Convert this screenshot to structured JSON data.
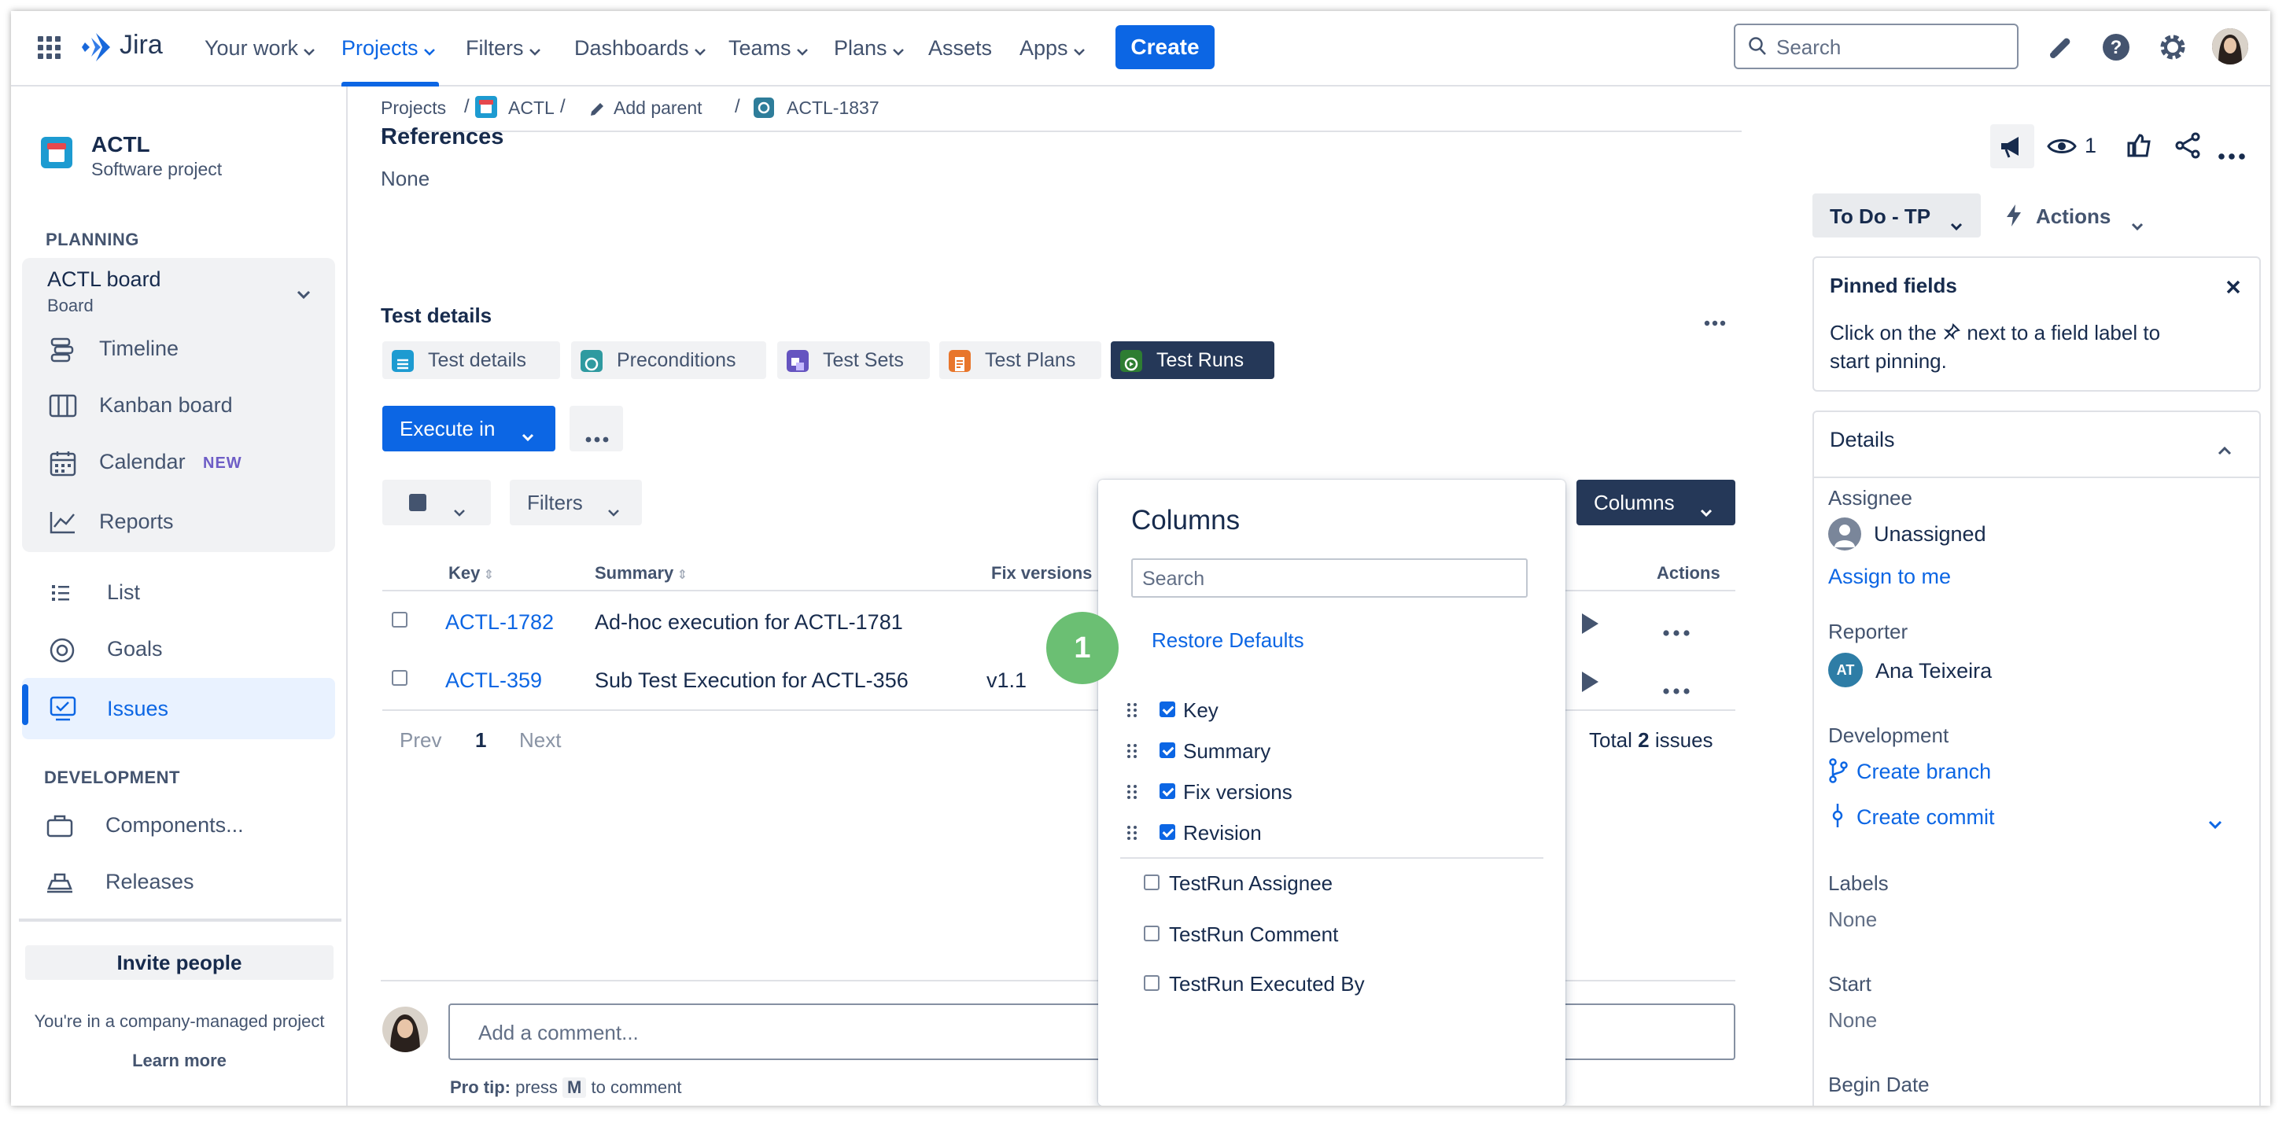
{
  "topnav": {
    "logo_text": "Jira",
    "items": [
      "Your work",
      "Projects",
      "Filters",
      "Dashboards",
      "Teams",
      "Plans",
      "Assets",
      "Apps"
    ],
    "create_label": "Create",
    "search_placeholder": "Search"
  },
  "sidebar": {
    "project_name": "ACTL",
    "project_type": "Software project",
    "planning_label": "PLANNING",
    "board_name": "ACTL board",
    "board_sub": "Board",
    "planning_items": [
      "Timeline",
      "Kanban board",
      "Calendar",
      "Reports"
    ],
    "calendar_badge": "NEW",
    "items": [
      "List",
      "Goals",
      "Issues"
    ],
    "development_label": "DEVELOPMENT",
    "dev_items": [
      "Components...",
      "Releases"
    ],
    "invite_label": "Invite people",
    "managed_text": "You're in a company-managed project",
    "learn_more": "Learn more"
  },
  "breadcrumb": {
    "projects": "Projects",
    "sep": "/",
    "project": "ACTL",
    "add_parent": "Add parent",
    "issue_key": "ACTL-1837"
  },
  "main": {
    "references_heading": "References",
    "references_value": "None",
    "test_details_heading": "Test details",
    "tabs": [
      "Test details",
      "Preconditions",
      "Test Sets",
      "Test Plans",
      "Test Runs"
    ],
    "execute_label": "Execute in",
    "filters_label": "Filters",
    "columns_label": "Columns",
    "table": {
      "headers": [
        "Key",
        "Summary",
        "Fix versions",
        "Actions"
      ],
      "rows": [
        {
          "key": "ACTL-1782",
          "summary": "Ad-hoc execution for ACTL-1781",
          "fix": ""
        },
        {
          "key": "ACTL-359",
          "summary": "Sub Test Execution for ACTL-356",
          "fix": "v1.1"
        }
      ]
    },
    "pagination": {
      "prev": "Prev",
      "page": "1",
      "next": "Next",
      "total_prefix": "Total",
      "total_count": "2",
      "total_suffix": "issues"
    },
    "comment_placeholder": "Add a comment...",
    "pro_tip_prefix": "Pro tip:",
    "pro_tip_press": "press",
    "pro_tip_key": "M",
    "pro_tip_suffix": "to comment"
  },
  "columns_popup": {
    "title": "Columns",
    "search_placeholder": "Search",
    "step_badge": "1",
    "restore_label": "Restore Defaults",
    "checked": [
      "Key",
      "Summary",
      "Fix versions",
      "Revision"
    ],
    "unchecked": [
      "TestRun Assignee",
      "TestRun Comment",
      "TestRun Executed By"
    ]
  },
  "right": {
    "watch_count": "1",
    "status_label": "To Do - TP",
    "actions_label": "Actions",
    "pinned_title": "Pinned fields",
    "pinned_text_1": "Click on the",
    "pinned_text_2": "next to a field label to",
    "pinned_text_3": "start pinning.",
    "details_label": "Details",
    "assignee_label": "Assignee",
    "assignee_value": "Unassigned",
    "assign_to_me": "Assign to me",
    "reporter_label": "Reporter",
    "reporter_initials": "AT",
    "reporter_value": "Ana Teixeira",
    "development_label": "Development",
    "create_branch": "Create branch",
    "create_commit": "Create commit",
    "labels_label": "Labels",
    "labels_value": "None",
    "start_label": "Start",
    "start_value": "None",
    "begin_date_label": "Begin Date"
  },
  "colors": {
    "brand": "#0c66e4",
    "active_tab": "#253858",
    "step_badge": "#6bbf73"
  }
}
